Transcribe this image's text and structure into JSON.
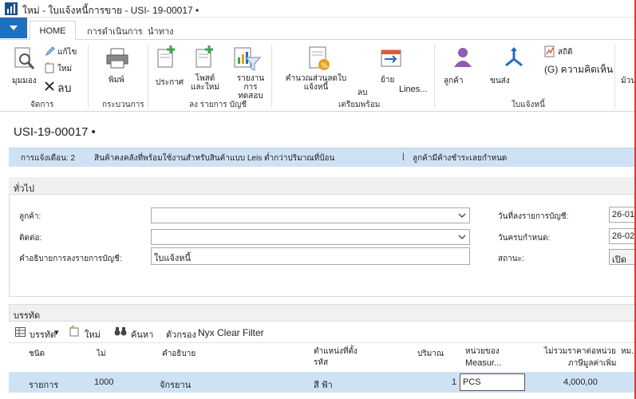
{
  "window": {
    "title": "ใหม่ - ใบแจ้งหนี้การขาย - USI-  19-00017 •"
  },
  "ribbon_tabs": {
    "home": "HOME",
    "actions": "การดำเนินการ",
    "navigate": "นำทาง"
  },
  "ribbon": {
    "view": "มุมมอง",
    "edit": "แก้ไข",
    "new": "ใหม่",
    "delete": "ลบ",
    "manage_group": "จัดการ",
    "print": "พิมพ์",
    "process_group": "กระบวนการ",
    "post": "ประกาศ",
    "post_new": "โพสต์และใหม่",
    "test_report": "รายงานการทดสอบ",
    "posting_group": "ลง รายการ บัญชี",
    "calc_discount": "คำนวณส่วนลดใบแจ้งหนี้",
    "delete_lines": "ลบ",
    "move": "ย้าย",
    "lines": "Lines...",
    "prepare_group": "เตรียมพร้อม",
    "customer": "ลูกค้า",
    "shipping": "ขนส่ง",
    "statistics": "สถิติ",
    "comments": "(G) ความคิดเห็น",
    "invoice_group": "ใบแจ้งหนี้",
    "approve": "ม้วน"
  },
  "page_title": "USI-19-00017 •",
  "notification": {
    "reminders": "การแจ้งเตือน: 2",
    "message": "สินค้าคงคลังที่พร้อมใช้งานสำหรับสินค้าแบบ Leis ต่ำกว่าปริมาณที่ป้อน",
    "separator": "|",
    "overdue": "ลูกค้ามีค้างชำระเลยกำหนด"
  },
  "general": {
    "heading": "ทั่วไป",
    "customer_label": "ลูกค้า:",
    "customer_value": "",
    "contact_label": "ติดต่อ:",
    "contact_value": "",
    "posting_desc_label": "คำอธิบายการลงรายการบัญชี:",
    "posting_desc_value": "ใบแจ้งหนี้",
    "posting_date_label": "วันที่ลงรายการบัญชี:",
    "posting_date_value": "26-01",
    "due_date_label": "วันครบกำหนด:",
    "due_date_value": "26-02",
    "status_label": "สถานะ:",
    "status_value": "เปิด"
  },
  "lines": {
    "heading": "บรรทัด",
    "toolbar": {
      "lines": "บรรทัด",
      "new": "ใหม่",
      "find": "ค้นหา",
      "filter": "ตัวกรอง",
      "clear_filter": "Nyx Clear Filter"
    },
    "columns": {
      "type": "ชนิด",
      "no": "ไม่",
      "description": "คำอธิบาย",
      "location_1": "ตำแหน่งที่ตั้ง",
      "location_2": "รหัส",
      "quantity": "ปริมาณ",
      "uom_1": "หน่วยของ",
      "uom_2": "Measur...",
      "unit_price_1": "ไม่รวมราคาต่อหน่วย",
      "unit_price_2": "ภาษีมูลค่าเพิ่ม",
      "discount": "หม..."
    },
    "rows": [
      {
        "type": "รายการ",
        "no": "1000",
        "description": "จักรยาน",
        "location": "สี ฟ้า",
        "quantity": "1",
        "uom": "PCS",
        "unit_price": "4,000,00"
      }
    ]
  },
  "colors": {
    "accent": "#1f6fc0",
    "selection": "#cfe2f3"
  }
}
